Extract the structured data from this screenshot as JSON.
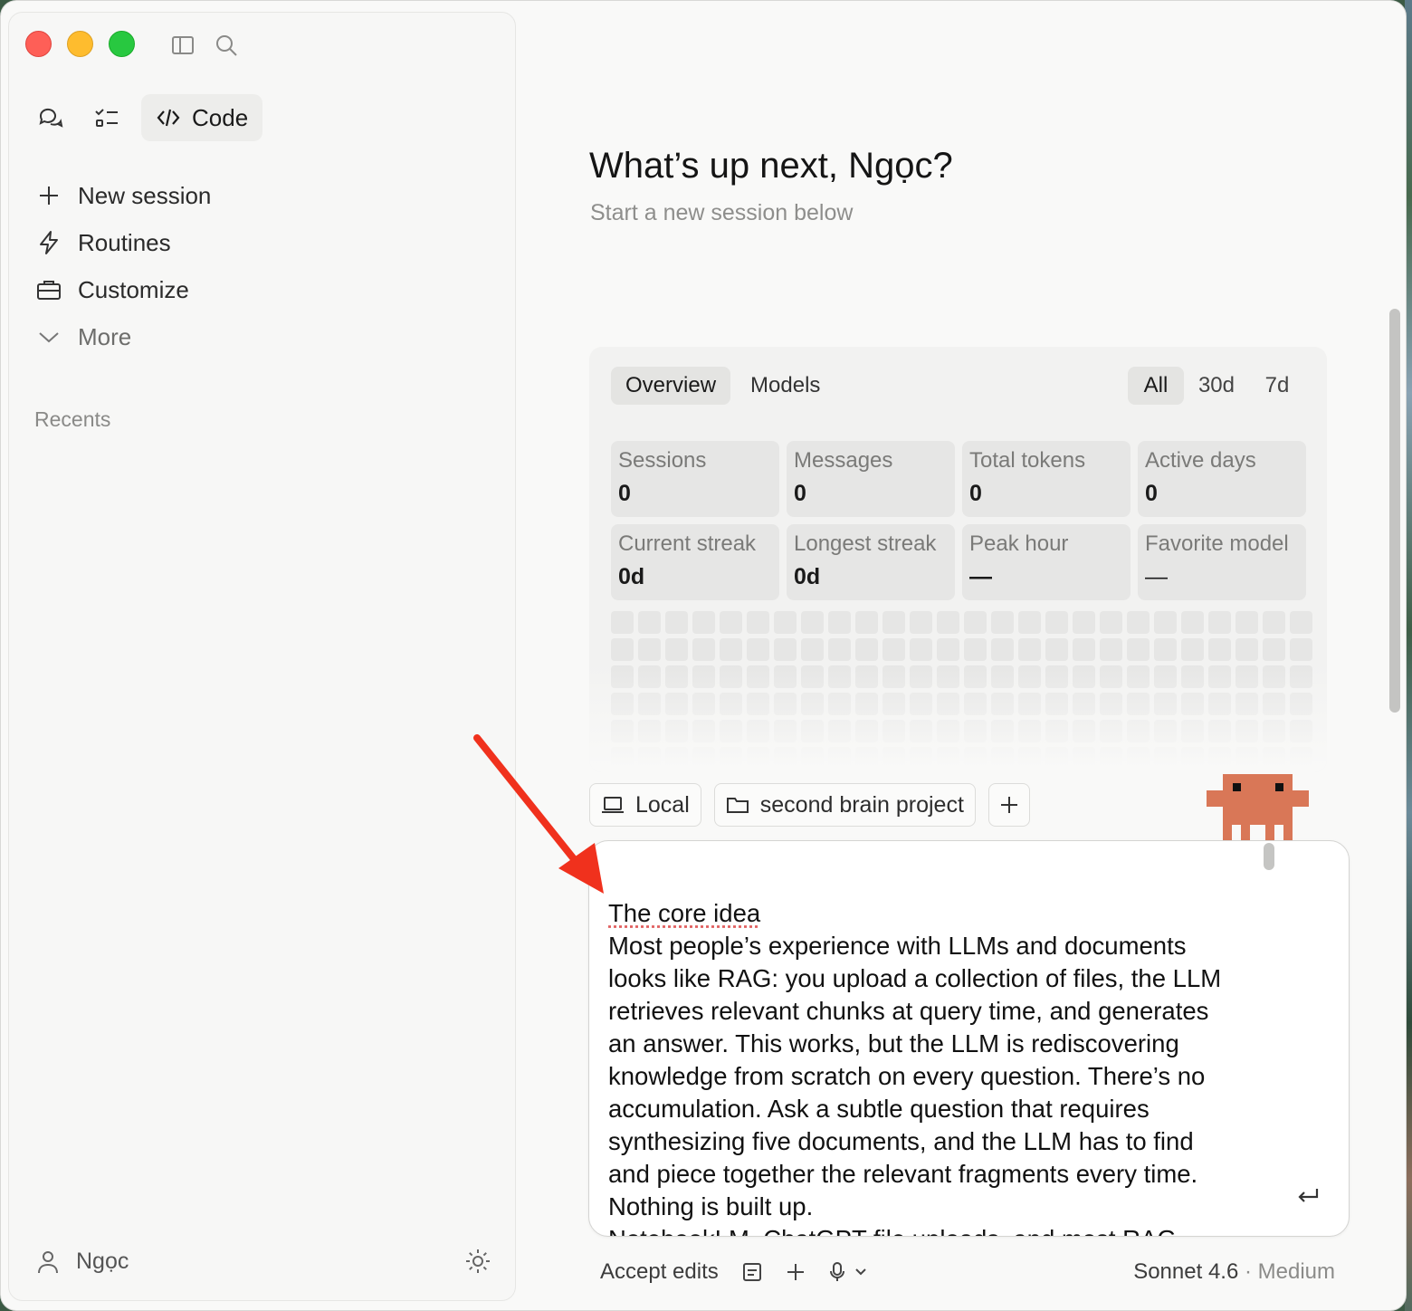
{
  "sidebar": {
    "modes": {
      "chat_icon": "chat-bubbles-icon",
      "tasks_icon": "checklist-icon",
      "code_label": "Code"
    },
    "nav": [
      {
        "label": "New session",
        "icon": "plus-icon"
      },
      {
        "label": "Routines",
        "icon": "bolt-icon"
      },
      {
        "label": "Customize",
        "icon": "briefcase-icon"
      },
      {
        "label": "More",
        "icon": "chevron-down-icon"
      }
    ],
    "recents_label": "Recents",
    "user_name": "Ngọc"
  },
  "main": {
    "greeting": "What’s up next, Ngọc?",
    "subtitle": "Start a new session below",
    "stats": {
      "tabs": [
        "Overview",
        "Models"
      ],
      "ranges": [
        "All",
        "30d",
        "7d"
      ],
      "cards": [
        {
          "label": "Sessions",
          "value": "0"
        },
        {
          "label": "Messages",
          "value": "0"
        },
        {
          "label": "Total tokens",
          "value": "0"
        },
        {
          "label": "Active days",
          "value": "0"
        },
        {
          "label": "Current streak",
          "value": "0d"
        },
        {
          "label": "Longest streak",
          "value": "0d"
        },
        {
          "label": "Peak hour",
          "value": "—"
        },
        {
          "label": "Favorite model",
          "value": "—"
        }
      ]
    },
    "chips": {
      "local": "Local",
      "project": "second brain project"
    },
    "input_text": {
      "heading": "The core idea",
      "body": "Most people’s experience with LLMs and documents looks like RAG: you upload a collection of files, the LLM retrieves relevant chunks at query time, and generates an answer. This works, but the LLM is rediscovering knowledge from scratch on every question. There’s no accumulation. Ask a subtle question that requires synthesizing five documents, and the LLM has to find and piece together the relevant fragments every time. Nothing is built up.",
      "cut_line": "NotebookLM, ChatGPT file uploads, and most RAG"
    },
    "bottom": {
      "accept_edits": "Accept edits",
      "model": "Sonnet 4.6",
      "separator": " · ",
      "effort": "Medium"
    }
  },
  "colors": {
    "accent_critter": "#d97757",
    "annotation_arrow": "#f0311d"
  }
}
